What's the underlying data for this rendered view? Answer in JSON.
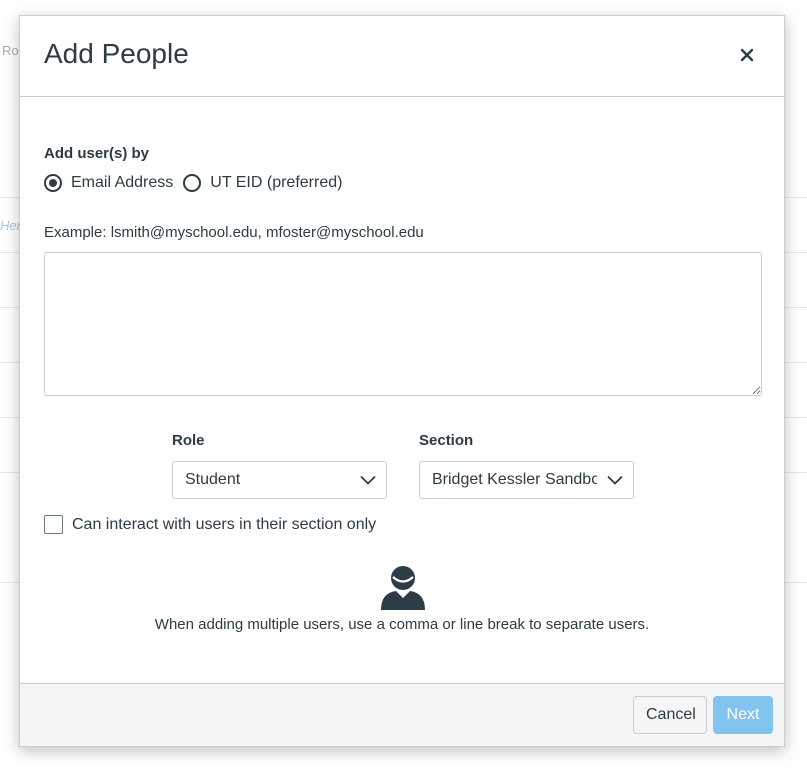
{
  "background": {
    "fragments": [
      "Ro",
      "Her"
    ]
  },
  "modal": {
    "title": "Add People",
    "close_icon": "close-icon"
  },
  "add_by": {
    "label": "Add user(s) by",
    "options": [
      {
        "label": "Email Address",
        "checked": true
      },
      {
        "label": "UT EID (preferred)",
        "checked": false
      }
    ]
  },
  "example": {
    "label": "Example: lsmith@myschool.edu, mfoster@myschool.edu"
  },
  "users_input": {
    "value": "",
    "placeholder": ""
  },
  "role": {
    "label": "Role",
    "selected": "Student"
  },
  "section": {
    "label": "Section",
    "selected": "Bridget Kessler Sandbo"
  },
  "limit_checkbox": {
    "label": "Can interact with users in their section only",
    "checked": false
  },
  "hint": {
    "icon": "person-icon",
    "text": "When adding multiple users, use a comma or line break to separate users."
  },
  "footer": {
    "cancel_label": "Cancel",
    "next_label": "Next"
  },
  "colors": {
    "text": "#2d3b45",
    "border": "#c7cdd1",
    "primary_disabled": "#82c4ef",
    "footer_bg": "#f5f5f5"
  }
}
